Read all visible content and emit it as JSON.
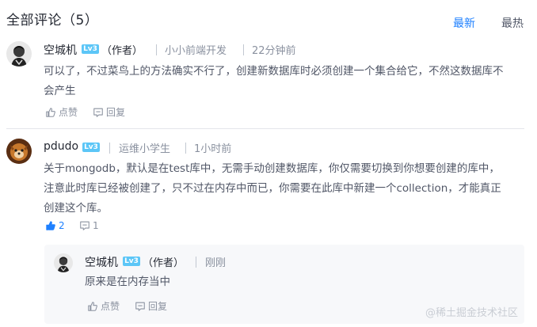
{
  "header": {
    "title": "全部评论（5）",
    "sort_latest": "最新",
    "sort_hot": "最热",
    "active_color": "#1e80ff"
  },
  "comments": [
    {
      "author": "空城机",
      "level": "Lv3",
      "author_tag": "（作者）",
      "title": "小小前端开发",
      "time": "22分钟前",
      "content_lines": [
        "可以了，不过菜鸟上的方法确实不行了，创建新数据库时必须创建一个集合给它，不然这数据库不",
        "会产生"
      ],
      "like_label": "点赞",
      "reply_label": "回复"
    },
    {
      "author": "pdudo",
      "level": "Lv3",
      "title": "运维小学生",
      "time": "1小时前",
      "content_lines": [
        "关于mongodb，默认是在test库中，无需手动创建数据库，你仅需要切换到你想要创建的库中，",
        "注意此时库已经被创建了，只不过在内存中而已，你需要在此库中新建一个collection，才能真正",
        "创建这个库。"
      ],
      "like_count": "2",
      "reply_count": "1",
      "reply": {
        "author": "空城机",
        "level": "Lv3",
        "author_tag": "（作者）",
        "time": "刚刚",
        "content": "原来是在内存当中",
        "like_label": "点赞",
        "reply_label": "回复"
      }
    }
  ],
  "watermark": "@稀土掘金技术社区",
  "icons": {
    "like": "thumbs-up-icon",
    "reply": "comment-icon",
    "level": "level-badge"
  }
}
